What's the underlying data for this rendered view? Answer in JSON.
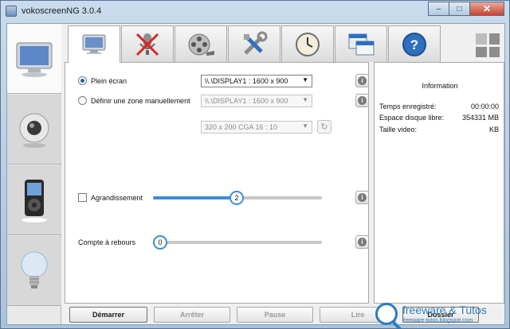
{
  "window": {
    "title": "vokoscreenNG 3.0.4",
    "controls": {
      "minimize": "–",
      "maximize": "□",
      "close": "✕"
    }
  },
  "sidebar": {
    "items": [
      {
        "icon": "monitor-icon",
        "active": true
      },
      {
        "icon": "webcam-icon",
        "active": false
      },
      {
        "icon": "media-player-icon",
        "active": false
      },
      {
        "icon": "lightbulb-icon",
        "active": false
      }
    ]
  },
  "tabs": [
    {
      "icon": "screen-icon",
      "active": true
    },
    {
      "icon": "microphone-muted-icon",
      "active": false
    },
    {
      "icon": "film-reel-icon",
      "active": false
    },
    {
      "icon": "tools-icon",
      "active": false
    },
    {
      "icon": "clock-icon",
      "active": false
    },
    {
      "icon": "folders-icon",
      "active": false
    },
    {
      "icon": "help-icon",
      "active": false
    }
  ],
  "screen": {
    "fullscreen_label": "Plein écran",
    "fullscreen_value": "\\\\.\\DISPLAY1 :  1600 x 900",
    "area_label": "Définir une zone manuellement",
    "area_value": "\\\\.\\DISPLAY1 :  1600 x 900",
    "area_size_value": "320 x 200 CGA 16 : 10",
    "magnify_label": "Agrandissement",
    "magnify_value": "2",
    "magnify_level": 0.5,
    "countdown_label": "Compte à rebours",
    "countdown_value": "0",
    "info_glyph": "i",
    "refresh_glyph": "↻"
  },
  "information": {
    "title": "Information",
    "rows": [
      {
        "label": "Temps enregistré:",
        "value": "00:00:00"
      },
      {
        "label": "Espace disque libre:",
        "value": "354331  MB"
      },
      {
        "label": "Taille video:",
        "value": "KB"
      }
    ]
  },
  "actions": {
    "start": "Démarrer",
    "stop": "Arrêter",
    "pause": "Pause",
    "play": "Lire",
    "folder": "Dossier"
  },
  "watermark": {
    "name": "freeware & Tutos",
    "url": "freeware-tutos.blogspot.com"
  },
  "colors": {
    "accent": "#3b8fd6",
    "titlebar": "#c9dced",
    "close": "#c7442f"
  }
}
